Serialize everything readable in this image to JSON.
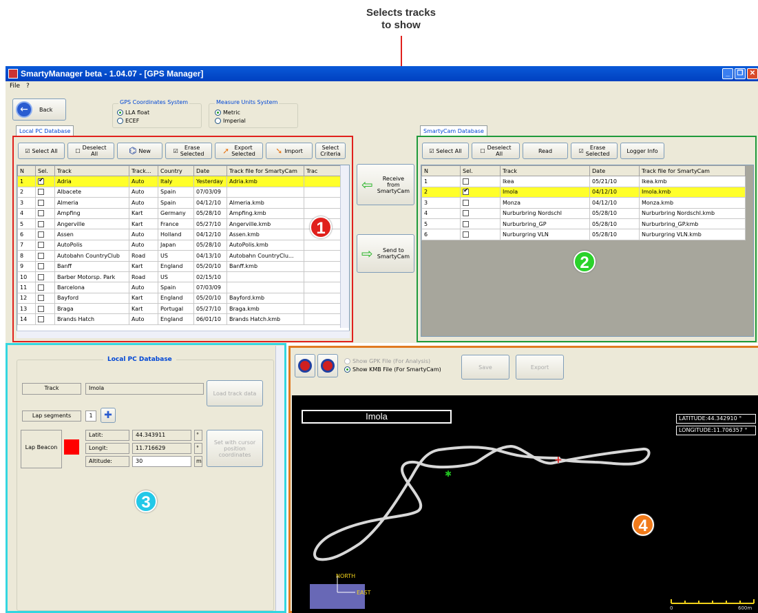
{
  "callout": {
    "line1": "Selects tracks",
    "line2": "to show"
  },
  "window": {
    "title": "SmartyManager beta - 1.04.07 - [GPS Manager]",
    "menu": [
      "File",
      "?"
    ]
  },
  "top": {
    "back_label": "Back",
    "gps_group": {
      "title": "GPS Coordinates System",
      "options": [
        "LLA float",
        "ECEF"
      ],
      "selected": "LLA float"
    },
    "units_group": {
      "title": "Measure Units System",
      "options": [
        "Metric",
        "Imperial"
      ],
      "selected": "Metric"
    }
  },
  "local_db": {
    "tab": "Local PC Database",
    "toolbar": {
      "select_all": "Select All",
      "deselect_all_1": "Deselect",
      "deselect_all_2": "All",
      "new": "New",
      "erase_1": "Erase",
      "erase_2": "Selected",
      "export_1": "Export",
      "export_2": "Selected",
      "import": "Import",
      "criteria_1": "Select",
      "criteria_2": "Criteria"
    },
    "columns": [
      "N",
      "Sel.",
      "Track",
      "Track...",
      "Country",
      "Date",
      "Track file for SmartyCam",
      "Trac"
    ],
    "rows": [
      {
        "n": "1",
        "sel": true,
        "track": "Adria",
        "type": "Auto",
        "country": "Italy",
        "date": "Yesterday",
        "file": "Adria.kmb",
        "selected": true
      },
      {
        "n": "2",
        "sel": false,
        "track": "Albacete",
        "type": "Auto",
        "country": "Spain",
        "date": "07/03/09",
        "file": ""
      },
      {
        "n": "3",
        "sel": false,
        "track": "Almeria",
        "type": "Auto",
        "country": "Spain",
        "date": "04/12/10",
        "file": "Almeria.kmb"
      },
      {
        "n": "4",
        "sel": false,
        "track": "Ampfing",
        "type": "Kart",
        "country": "Germany",
        "date": "05/28/10",
        "file": "Ampfing.kmb"
      },
      {
        "n": "5",
        "sel": false,
        "track": "Angerville",
        "type": "Kart",
        "country": "France",
        "date": "05/27/10",
        "file": "Angerville.kmb"
      },
      {
        "n": "6",
        "sel": false,
        "track": "Assen",
        "type": "Auto",
        "country": "Holland",
        "date": "04/12/10",
        "file": "Assen.kmb"
      },
      {
        "n": "7",
        "sel": false,
        "track": "AutoPolis",
        "type": "Auto",
        "country": "Japan",
        "date": "05/28/10",
        "file": "AutoPolis.kmb"
      },
      {
        "n": "8",
        "sel": false,
        "track": "Autobahn CountryClub",
        "type": "Road",
        "country": "US",
        "date": "04/13/10",
        "file": "Autobahn CountryClu..."
      },
      {
        "n": "9",
        "sel": false,
        "track": "Banff",
        "type": "Kart",
        "country": "England",
        "date": "05/20/10",
        "file": "Banff.kmb"
      },
      {
        "n": "10",
        "sel": false,
        "track": "Barber Motorsp. Park",
        "type": "Road",
        "country": "US",
        "date": "02/15/10",
        "file": ""
      },
      {
        "n": "11",
        "sel": false,
        "track": "Barcelona",
        "type": "Auto",
        "country": "Spain",
        "date": "07/03/09",
        "file": ""
      },
      {
        "n": "12",
        "sel": false,
        "track": "Bayford",
        "type": "Kart",
        "country": "England",
        "date": "05/20/10",
        "file": "Bayford.kmb"
      },
      {
        "n": "13",
        "sel": false,
        "track": "Braga",
        "type": "Kart",
        "country": "Portugal",
        "date": "05/27/10",
        "file": "Braga.kmb"
      },
      {
        "n": "14",
        "sel": false,
        "track": "Brands Hatch",
        "type": "Auto",
        "country": "England",
        "date": "06/01/10",
        "file": "Brands Hatch.kmb"
      }
    ],
    "badge": "1"
  },
  "middle": {
    "receive_1": "Receive",
    "receive_2": "from",
    "receive_3": "SmartyCam",
    "send_1": "Send to",
    "send_2": "SmartyCam"
  },
  "cam_db": {
    "tab": "SmartyCam Database",
    "toolbar": {
      "select_all": "Select All",
      "deselect_1": "Deselect",
      "deselect_2": "All",
      "read": "Read",
      "erase_1": "Erase",
      "erase_2": "Selected",
      "logger": "Logger Info"
    },
    "columns": [
      "N",
      "Sel.",
      "Track",
      "Date",
      "Track file for SmartyCam"
    ],
    "rows": [
      {
        "n": "1",
        "sel": false,
        "track": "Ikea",
        "date": "05/21/10",
        "file": "Ikea.kmb"
      },
      {
        "n": "2",
        "sel": true,
        "track": "Imola",
        "date": "04/12/10",
        "file": "Imola.kmb",
        "selected": true
      },
      {
        "n": "3",
        "sel": false,
        "track": "Monza",
        "date": "04/12/10",
        "file": "Monza.kmb"
      },
      {
        "n": "4",
        "sel": false,
        "track": "Nurburbring Nordschl",
        "date": "05/28/10",
        "file": "Nurburbring Nordschl.kmb"
      },
      {
        "n": "5",
        "sel": false,
        "track": "Nurburbring_GP",
        "date": "05/28/10",
        "file": "Nurburbring_GP.kmb"
      },
      {
        "n": "6",
        "sel": false,
        "track": "Nurburgring VLN",
        "date": "05/28/10",
        "file": "Nurburgring VLN.kmb"
      }
    ],
    "badge": "2"
  },
  "detail": {
    "title": "Local PC Database",
    "track_label": "Track",
    "track_value": "Imola",
    "load_btn": "Load track data",
    "lap_seg_label": "Lap segments",
    "lap_seg_value": "1",
    "beacon_label": "Lap Beacon",
    "lat_label": "Latit:",
    "lat_value": "44.343911",
    "lat_unit": "°",
    "lon_label": "Longit:",
    "lon_value": "11.716629",
    "lon_unit": "°",
    "alt_label": "Altitude:",
    "alt_value": "30",
    "alt_unit": "m",
    "cursor_btn_1": "Set with cursor",
    "cursor_btn_2": "position",
    "cursor_btn_3": "coordinates",
    "badge": "3"
  },
  "map": {
    "show_gpk": "Show GPK File (For Analysis)",
    "show_kmb": "Show KMB File (For SmartyCam)",
    "save": "Save",
    "export": "Export",
    "track_name": "Imola",
    "latitude": "LATITUDE:44.342910 °",
    "longitude": "LONGITUDE:11.706357 °",
    "north": "NORTH",
    "east": "EAST",
    "scale_start": "0",
    "scale_end": "600m",
    "badge": "4"
  },
  "colors": {
    "local_border": "#e0201c",
    "cam_border": "#1e9a3a",
    "detail_border": "#33d6e0",
    "map_border": "#e07a20",
    "badge1": "#e0201c",
    "badge2": "#2ad22a",
    "badge3": "#22c8e8",
    "badge4": "#f07a1a"
  }
}
